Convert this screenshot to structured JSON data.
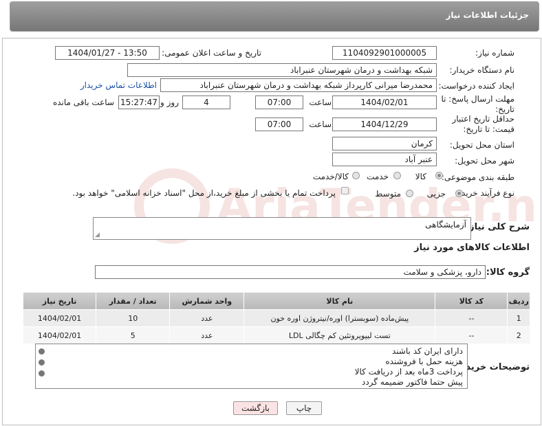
{
  "header": {
    "title": "جزئیات اطلاعات نیاز"
  },
  "form": {
    "need_number_label": "شماره نیاز:",
    "need_number": "1104092901000005",
    "announce_label": "تاریخ و ساعت اعلان عمومی:",
    "announce_value": "1404/01/27 - 13:50",
    "buyer_org_label": "نام دستگاه خریدار:",
    "buyer_org": "شبکه بهداشت و درمان شهرستان عنبراباد",
    "requester_label": "ایجاد کننده درخواست:",
    "requester": "محمدرضا میرانی کارپرداز  شبکه بهداشت و درمان شهرستان عنبراباد",
    "contact_link": "اطلاعات تماس خریدار",
    "deadline_label": "مهلت ارسال پاسخ: تا تاریخ:",
    "deadline_date": "1404/02/01",
    "time_label": "ساعت",
    "deadline_time": "07:00",
    "days_value": "4",
    "days_label": "روز و",
    "remaining_time": "15:27:47",
    "remaining_label": "ساعت باقی مانده",
    "validity_label": "حداقل تاریخ اعتبار قیمت: تا تاریخ:",
    "validity_date": "1404/12/29",
    "validity_time": "07:00",
    "province_label": "استان محل تحویل:",
    "province": "کرمان",
    "city_label": "شهر محل تحویل:",
    "city": "عنبر آباد",
    "category_label": "طبقه بندی موضوعی:",
    "category_options": [
      "کالا",
      "خدمت",
      "کالا/خدمت"
    ],
    "category_selected": "کالا",
    "process_label": "نوع فرآیند خرید :",
    "process_options": [
      "جزیی",
      "متوسط"
    ],
    "process_selected": "جزیی",
    "payment_note": "پرداخت تمام یا بخشی از مبلغ خرید،از محل \"اسناد خزانه اسلامی\" خواهد بود."
  },
  "summary": {
    "label": "شرح کلی نیاز:",
    "value": "آزمایشگاهی"
  },
  "goods_section": {
    "title": "اطلاعات کالاهای مورد نیاز",
    "group_label": "گروه کالا:",
    "group_value": "دارو، پزشکی و سلامت"
  },
  "table": {
    "headers": [
      "ردیف",
      "کد کالا",
      "نام کالا",
      "واحد شمارش",
      "تعداد / مقدار",
      "تاریخ نیاز"
    ],
    "rows": [
      [
        "1",
        "--",
        "پیش‌ماده (سوبسترا) اوره/نیتروژن اوره خون",
        "عدد",
        "10",
        "1404/02/01"
      ],
      [
        "2",
        "--",
        "تست لیپوپروتئین کم چگالی LDL",
        "عدد",
        "5",
        "1404/02/01"
      ]
    ]
  },
  "buyer_notes": {
    "label": "توضیحات خریدار:",
    "lines": [
      "دارای ایران کد باشند",
      "هزینه حمل با فروشنده",
      "پرداخت 3ماه بعد از دریافت کالا",
      "پیش حتما فاکتور ضمیمه گردد"
    ]
  },
  "buttons": {
    "print": "چاپ",
    "back": "بازگشت"
  },
  "watermark": {
    "text": "AriaTender.net"
  },
  "colors": {
    "header_bg": "#8a8a8a",
    "link": "#1a4fa3",
    "back_button_bg": "#fbe3e3",
    "watermark": "#c0392b"
  }
}
